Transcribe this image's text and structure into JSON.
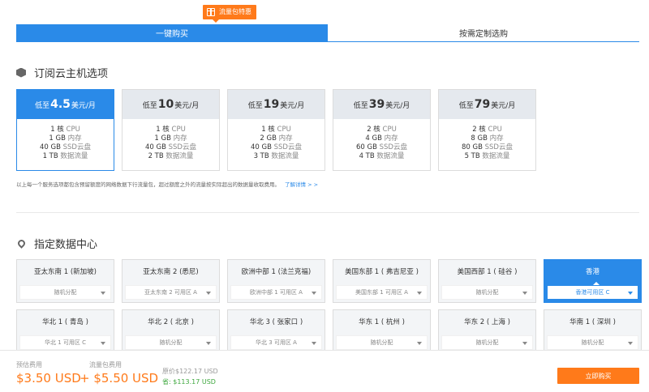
{
  "tabs": [
    {
      "label": "一键购买",
      "active": true
    },
    {
      "label": "按需定制选购",
      "active": false
    }
  ],
  "promo_badge": "流量包特惠",
  "subscribe_section": {
    "title": "订阅云主机选项"
  },
  "plans": [
    {
      "prefix": "低至",
      "price": "4.5",
      "suffix": "美元/月",
      "cpu": "1 核",
      "mem": "1 GB",
      "disk": "40 GB",
      "traffic": "1 TB",
      "active": true
    },
    {
      "prefix": "低至",
      "price": "10",
      "suffix": "美元/月",
      "cpu": "1 核",
      "mem": "1 GB",
      "disk": "40 GB",
      "traffic": "2 TB",
      "active": false
    },
    {
      "prefix": "低至",
      "price": "19",
      "suffix": "美元/月",
      "cpu": "1 核",
      "mem": "2 GB",
      "disk": "40 GB",
      "traffic": "3 TB",
      "active": false
    },
    {
      "prefix": "低至",
      "price": "39",
      "suffix": "美元/月",
      "cpu": "2 核",
      "mem": "4 GB",
      "disk": "60 GB",
      "traffic": "4 TB",
      "active": false
    },
    {
      "prefix": "低至",
      "price": "79",
      "suffix": "美元/月",
      "cpu": "2 核",
      "mem": "8 GB",
      "disk": "80 GB",
      "traffic": "5 TB",
      "active": false
    }
  ],
  "spec_units": {
    "cpu": "CPU",
    "mem": "内存",
    "disk": "SSD云盘",
    "traffic": "数据流量"
  },
  "note": {
    "text": "以上每一个服务选项都包含预留额度的网络数据下行流量包，超过额度之外的流量按实际超出的数据量收取费用。",
    "link": "了解详情 > >"
  },
  "datacenter_section": {
    "title": "指定数据中心"
  },
  "regions": [
    {
      "name": "亚太东南 1 (新加坡)",
      "zone": "随机分配",
      "active": false
    },
    {
      "name": "亚太东南 2 (悉尼)",
      "zone": "亚太东南 2 可用区 A",
      "active": false
    },
    {
      "name": "欧洲中部 1 (法兰克福)",
      "zone": "欧洲中部 1 可用区 A",
      "active": false
    },
    {
      "name": "美国东部 1 ( 弗吉尼亚 )",
      "zone": "美国东部 1 可用区 A",
      "active": false
    },
    {
      "name": "美国西部 1 ( 硅谷 )",
      "zone": "随机分配",
      "active": false
    },
    {
      "name": "香港",
      "zone": "香港可用区 C",
      "active": true
    },
    {
      "name": "华北 1 ( 青岛 )",
      "zone": "华北 1 可用区 C",
      "active": false
    },
    {
      "name": "华北 2 ( 北京 )",
      "zone": "随机分配",
      "active": false
    },
    {
      "name": "华北 3 ( 张家口 )",
      "zone": "华北 3 可用区 A",
      "active": false
    },
    {
      "name": "华东 1 ( 杭州 )",
      "zone": "随机分配",
      "active": false
    },
    {
      "name": "华东 2 ( 上海 )",
      "zone": "随机分配",
      "active": false
    },
    {
      "name": "华南 1 ( 深圳 )",
      "zone": "随机分配",
      "active": false
    }
  ],
  "footer": {
    "estimate_label": "预估费用",
    "estimate_price": "$3.50 USD",
    "traffic_label": "流量包费用",
    "traffic_price": "+ $5.50 USD",
    "original": "原价$122.17 USD",
    "saving": "省: $113.17 USD",
    "buy_button": "立即购买"
  },
  "colors": {
    "accent": "#2a8ae8",
    "orange": "#ff7a1a",
    "green": "#3fa83f"
  }
}
